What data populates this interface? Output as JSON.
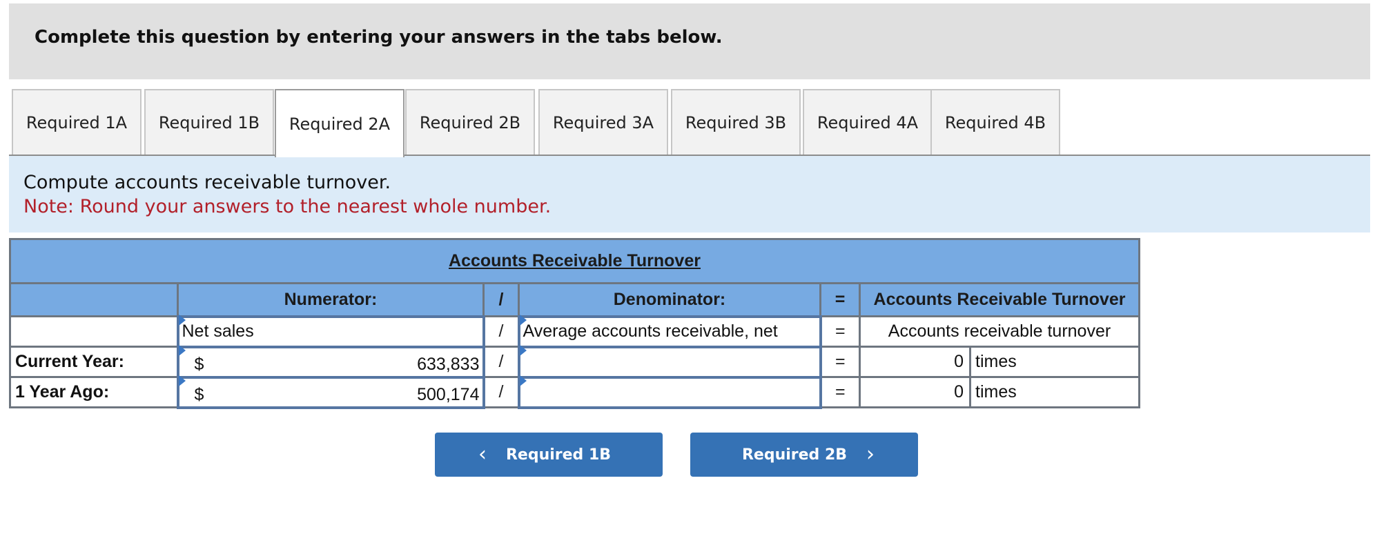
{
  "header": {
    "title": "Complete this question by entering your answers in the tabs below."
  },
  "tabs": [
    {
      "label": "Required 1A",
      "active": false
    },
    {
      "label": "Required 1B",
      "active": false
    },
    {
      "label": "Required 2A",
      "active": true
    },
    {
      "label": "Required 2B",
      "active": false
    },
    {
      "label": "Required 3A",
      "active": false
    },
    {
      "label": "Required 3B",
      "active": false
    },
    {
      "label": "Required 4A",
      "active": false
    },
    {
      "label": "Required 4B",
      "active": false
    }
  ],
  "instructions": {
    "main": "Compute accounts receivable turnover.",
    "note": "Note: Round your answers to the nearest whole number."
  },
  "table": {
    "title": "Accounts Receivable Turnover",
    "headers": {
      "numerator": "Numerator:",
      "divide": "/",
      "denominator": "Denominator:",
      "equals": "=",
      "result": "Accounts Receivable Turnover"
    },
    "formula_row": {
      "numerator": "Net sales",
      "divide": "/",
      "denominator": "Average accounts receivable, net",
      "equals": "=",
      "result": "Accounts receivable turnover"
    },
    "rows": [
      {
        "label": "Current Year:",
        "currency": "$",
        "numerator": "633,833",
        "divide": "/",
        "denominator": "",
        "equals": "=",
        "result": "0",
        "unit": "times"
      },
      {
        "label": "1 Year Ago:",
        "currency": "$",
        "numerator": "500,174",
        "divide": "/",
        "denominator": "",
        "equals": "=",
        "result": "0",
        "unit": "times"
      }
    ]
  },
  "nav": {
    "prev_label": "Required 1B",
    "next_label": "Required 2B",
    "prev_icon": "chevron-left-icon",
    "next_icon": "chevron-right-icon"
  },
  "colors": {
    "accent": "#3572b5",
    "table_header": "#77aae2",
    "note": "#b2202a",
    "instruction_bg": "#dcebf8"
  }
}
